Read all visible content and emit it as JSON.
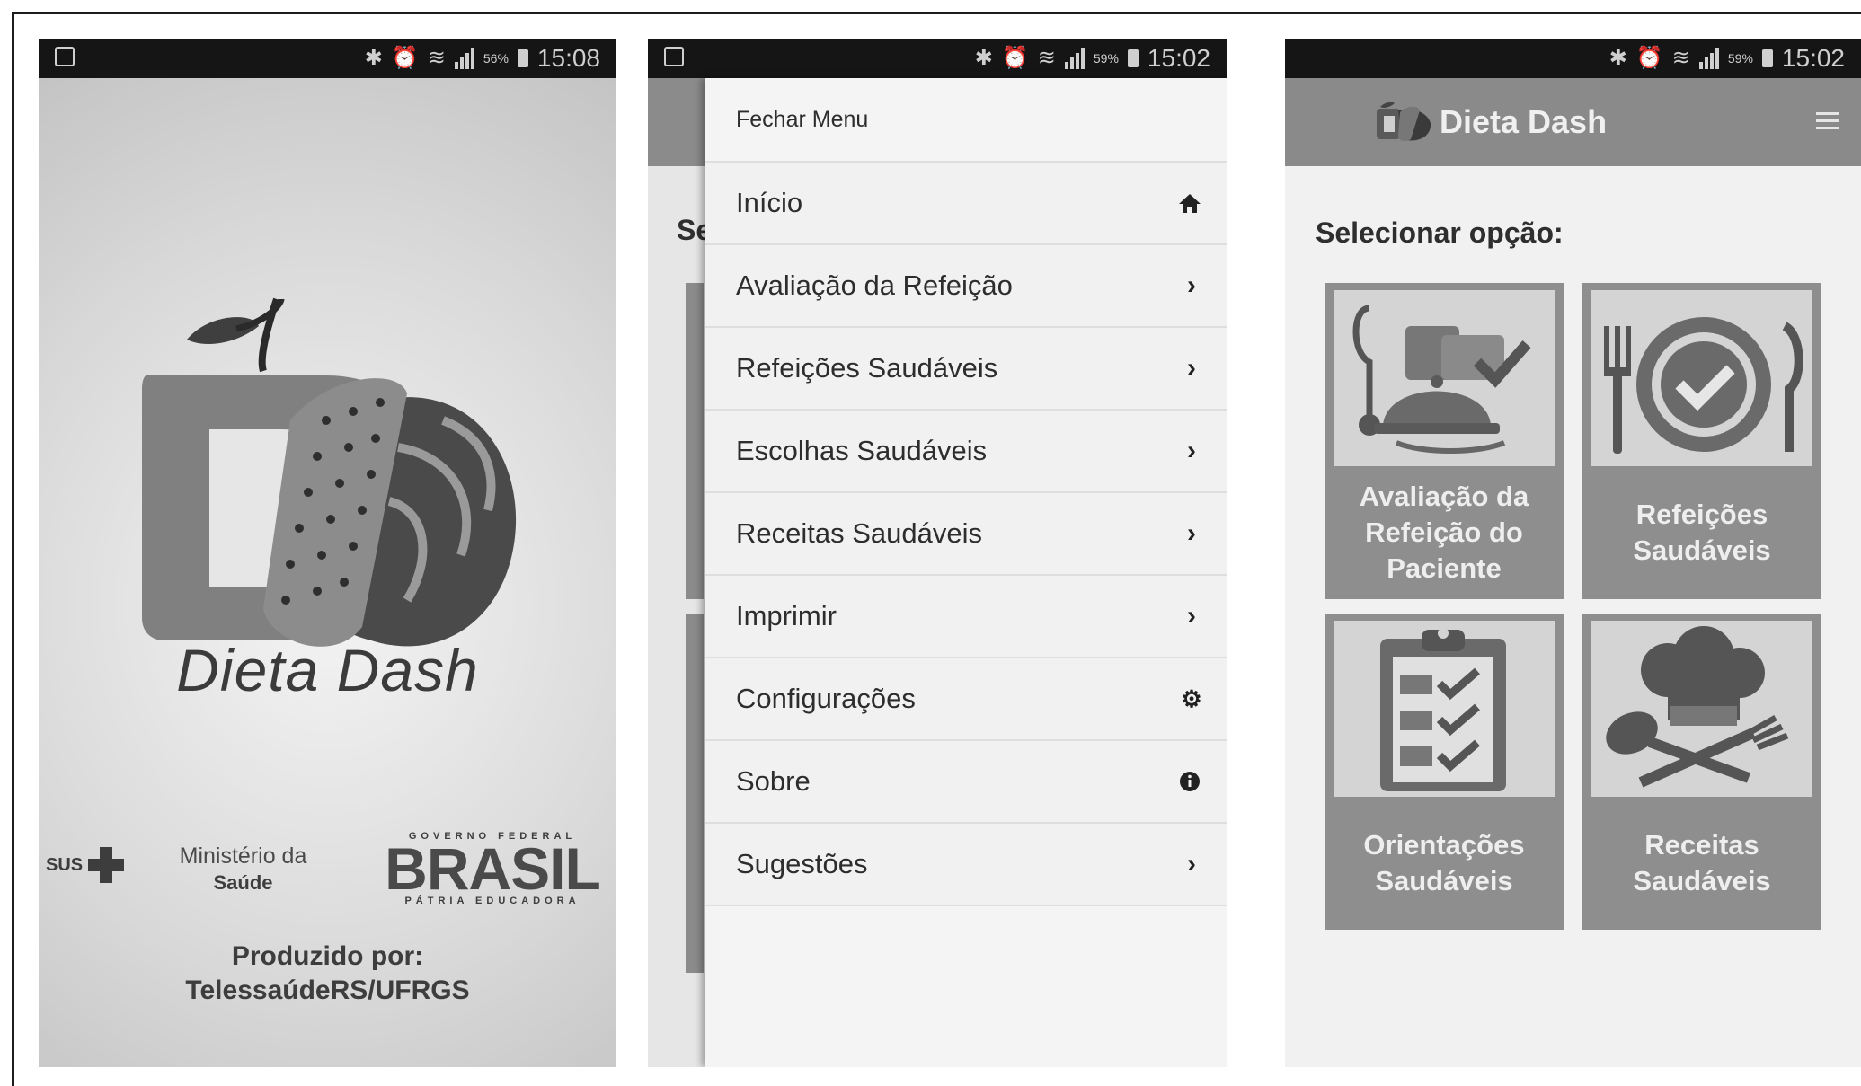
{
  "status_bar": {
    "screen1": {
      "battery": "56%",
      "time": "15:08"
    },
    "screen2": {
      "battery": "59%",
      "time": "15:02"
    },
    "screen3": {
      "battery": "59%",
      "time": "15:02"
    }
  },
  "splash": {
    "app_name": "Dieta Dash",
    "sus_label": "SUS",
    "ministerio_line1": "Ministério da",
    "ministerio_line2": "Saúde",
    "brasil_top": "GOVERNO FEDERAL",
    "brasil_main": "BRASIL",
    "brasil_bottom": "PÁTRIA EDUCADORA",
    "produced_by_label": "Produzido por:",
    "produced_by": "TelessaúdeRS/UFRGS"
  },
  "drawer": {
    "background_text": "Se",
    "close_label": "Fechar Menu",
    "items": [
      {
        "label": "Início",
        "icon": "home-icon"
      },
      {
        "label": "Avaliação da Refeição",
        "icon": "chevron-right-icon"
      },
      {
        "label": "Refeições Saudáveis",
        "icon": "chevron-right-icon"
      },
      {
        "label": "Escolhas Saudáveis",
        "icon": "chevron-right-icon"
      },
      {
        "label": "Receitas Saudáveis",
        "icon": "chevron-right-icon"
      },
      {
        "label": "Imprimir",
        "icon": "chevron-right-icon"
      },
      {
        "label": "Configurações",
        "icon": "gear-icon"
      },
      {
        "label": "Sobre",
        "icon": "info-icon"
      },
      {
        "label": "Sugestões",
        "icon": "chevron-right-icon"
      }
    ]
  },
  "home": {
    "title": "Dieta Dash",
    "select_label": "Selecionar opção:",
    "tiles": [
      {
        "line1": "Avaliação da",
        "line2": "Refeição do",
        "line3": "Paciente",
        "icon": "meal-evaluation-icon"
      },
      {
        "line1": "Refeições",
        "line2": "Saudáveis",
        "icon": "plate-check-icon"
      },
      {
        "line1": "Orientações",
        "line2": "Saudáveis",
        "icon": "clipboard-checklist-icon"
      },
      {
        "line1": "Receitas",
        "line2": "Saudáveis",
        "icon": "chef-hat-utensils-icon"
      }
    ]
  }
}
